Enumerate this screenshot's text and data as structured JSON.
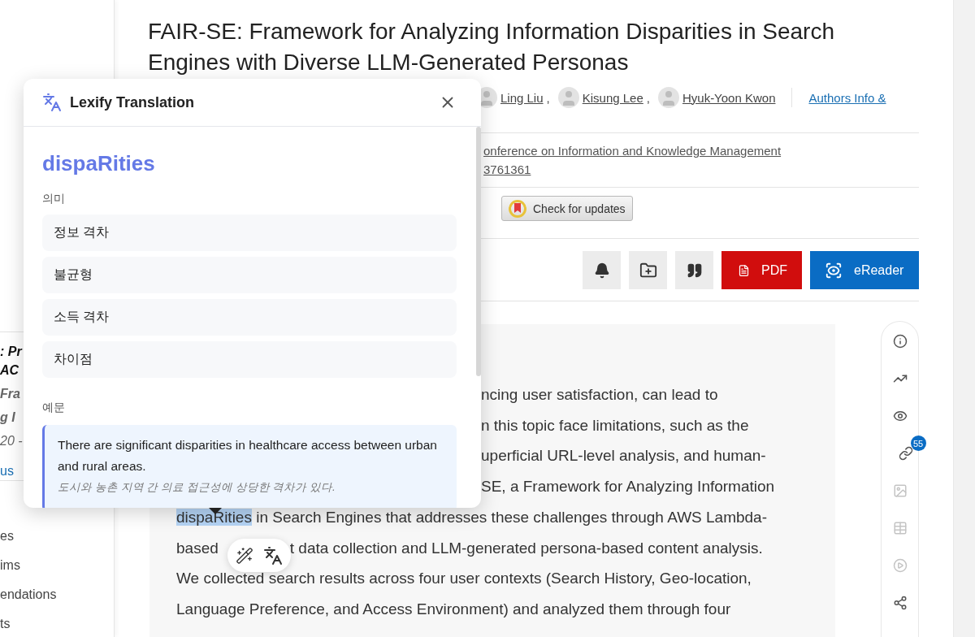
{
  "sidebar": {
    "card_lines": [
      {
        "text": ": Pr",
        "kind": "title"
      },
      {
        "text": "AC",
        "kind": "title"
      },
      {
        "text": "Fra",
        "kind": "subtitle"
      },
      {
        "text": "g I",
        "kind": "subtitle"
      },
      {
        "text": "20 -",
        "kind": "meta"
      },
      {
        "text": "us",
        "kind": "link"
      }
    ],
    "items": [
      "es",
      "ims",
      "endations",
      "ts"
    ]
  },
  "article": {
    "title": "FAIR-SE: Framework for Analyzing Information Disparities in Search Engines with Diverse LLM-Generated Personas",
    "authors": [
      {
        "name": "Ling Liu",
        "separator": ","
      },
      {
        "name": "Kisung Lee",
        "separator": ","
      },
      {
        "name": "Hyuk-Yoon Kwon"
      }
    ],
    "authors_link": "Authors Info &",
    "venue_lines": [
      "onference on Information and Knowledge Management",
      "3761361"
    ],
    "updates_button": "Check for updates",
    "actions": [
      {
        "label": "PDF",
        "kind": "pdf"
      },
      {
        "label": "eReader",
        "kind": "reader"
      }
    ],
    "abstract_lines": [
      {
        "kind": "cut",
        "text": "ncing user satisfaction, can lead to"
      },
      {
        "kind": "cut",
        "text": "n this topic face limitations, such as the"
      },
      {
        "kind": "cut",
        "text": "uperficial URL-level analysis, and human-"
      },
      {
        "kind": "cut",
        "text": "SE, a Framework for Analyzing Information"
      },
      {
        "kind": "selected",
        "highlight": "dispaRities",
        "text": " in Search Engines that addresses these challenges through AWS Lambda-"
      },
      {
        "kind": "covered",
        "text": "based",
        "rest": "t data collection and LLM-generated persona-based content analysis."
      },
      {
        "kind": "full",
        "text": "We collected search results across four user contexts (Search History, Geo-location,"
      },
      {
        "kind": "full",
        "text": "Language Preference, and Access Environment) and analyzed them through four"
      }
    ]
  },
  "rail": {
    "items": [
      {
        "disabled": false
      },
      {
        "disabled": false
      },
      {
        "disabled": false
      },
      {
        "disabled": false,
        "badge": "55"
      },
      {
        "disabled": true
      },
      {
        "disabled": true
      },
      {
        "disabled": true
      },
      {
        "disabled": false
      }
    ]
  },
  "popup": {
    "title": "Lexify Translation",
    "word": "dispaRities",
    "meanings_label": "의미",
    "meanings": [
      "정보 격차",
      "불균형",
      "소득 격차",
      "차이점"
    ],
    "examples_label": "예문",
    "example": {
      "text": "There are significant disparities in healthcare access between urban and rural areas.",
      "translation": "도시와 농촌 지역 간 의료 접근성에 상당한 격차가 있다."
    }
  }
}
